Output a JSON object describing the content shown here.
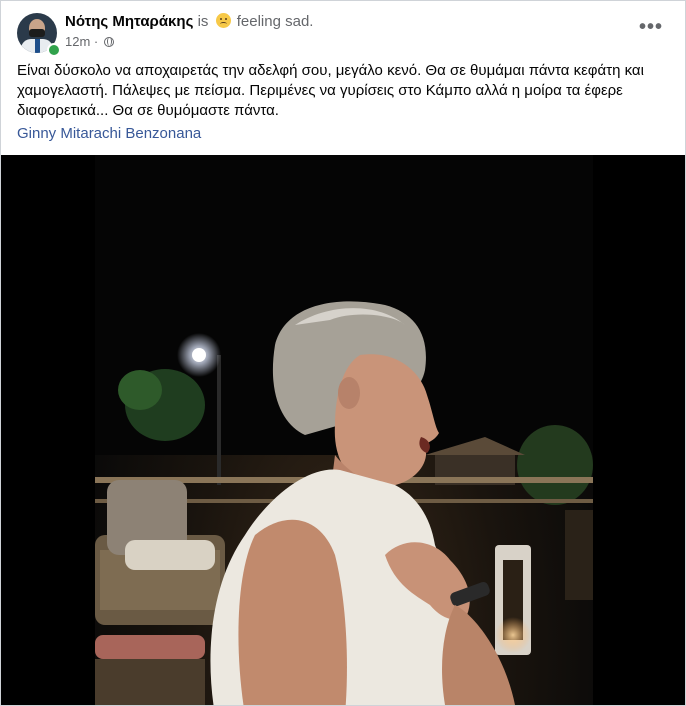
{
  "post": {
    "author_name": "Νότης Μηταράκης",
    "feeling_prefix": "is",
    "feeling_text": "feeling sad.",
    "feeling_icon": "sad-face-emoji",
    "timestamp": "12m",
    "audience_icon": "globe-icon",
    "more_icon": "more-options-icon",
    "more_label": "•••",
    "text": "Είναι δύσκολο να αποχαιρετάς την αδελφή σου, μεγάλο κενό. Θα σε θυμάμαι πάντα κεφάτη και\nχαμογελαστή. Πάλεψες με πείσμα. Περιμένες να γυρίσεις στο Κάμπο αλλά η μοίρα τα έφερε\nδιαφορετικά... Θα σε θυμόμαστε πάντα.",
    "tagged_person": "Ginny Mitarachi Benzonana"
  },
  "colors": {
    "link": "#385898",
    "online": "#31a24c",
    "secondary_text": "#65676b"
  }
}
